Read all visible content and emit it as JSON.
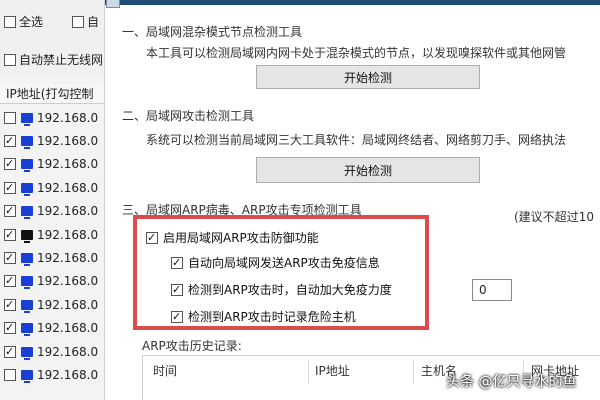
{
  "left_panel": {
    "select_all_label": "全选",
    "second_checkbox_label": "自",
    "auto_disable_wireless_label": "自动禁止无线网",
    "ip_column_header": "IP地址(打勾控制",
    "hosts": [
      {
        "ip": "192.168.0",
        "checked": false,
        "icon_color": "#1a3fd6"
      },
      {
        "ip": "192.168.0",
        "checked": true,
        "icon_color": "#1a3fd6"
      },
      {
        "ip": "192.168.0",
        "checked": true,
        "icon_color": "#1a3fd6"
      },
      {
        "ip": "192.168.0",
        "checked": true,
        "icon_color": "#1a3fd6"
      },
      {
        "ip": "192.168.0",
        "checked": true,
        "icon_color": "#1a3fd6"
      },
      {
        "ip": "192.168.0",
        "checked": true,
        "icon_color": "#111111"
      },
      {
        "ip": "192.168.0",
        "checked": true,
        "icon_color": "#1a3fd6"
      },
      {
        "ip": "192.168.0",
        "checked": true,
        "icon_color": "#1a3fd6"
      },
      {
        "ip": "192.168.0",
        "checked": true,
        "icon_color": "#1a3fd6"
      },
      {
        "ip": "192.168.0",
        "checked": true,
        "icon_color": "#1a3fd6"
      },
      {
        "ip": "192.168.0",
        "checked": true,
        "icon_color": "#1a3fd6"
      },
      {
        "ip": "192.168.0",
        "checked": false,
        "icon_color": "#1a3fd6"
      }
    ]
  },
  "section1": {
    "title": "一、局域网混杂模式节点检测工具",
    "desc": "本工具可以检测局域网内网卡处于混杂模式的节点，以发现嗅探软件或其他网管",
    "button": "开始检测"
  },
  "section2": {
    "title": "二、局域网攻击检测工具",
    "desc": "系统可以检测当前局域网三大工具软件：局域网终结者、网络剪刀手、网络执法",
    "button": "开始检测"
  },
  "section3": {
    "title": "三、局域网ARP病毒、ARP攻击专项检测工具",
    "hint": "(建议不超过10",
    "options": [
      {
        "label": "启用局域网ARP攻击防御功能",
        "checked": true
      },
      {
        "label": "自动向局域网发送ARP攻击免疫信息",
        "checked": true
      },
      {
        "label": "检测到ARP攻击时，自动加大免疫力度",
        "checked": true
      },
      {
        "label": "检测到ARP攻击时记录危险主机",
        "checked": true
      }
    ],
    "spin_value": "0",
    "history_label": "ARP攻击历史记录:",
    "history_columns": [
      "时间",
      "IP地址",
      "主机名",
      "网卡地址"
    ]
  },
  "watermark": "头条 @亿只寻水的鱼",
  "colors": {
    "highlight": "#dd4b4b",
    "title_bar": "#1f4e79"
  }
}
